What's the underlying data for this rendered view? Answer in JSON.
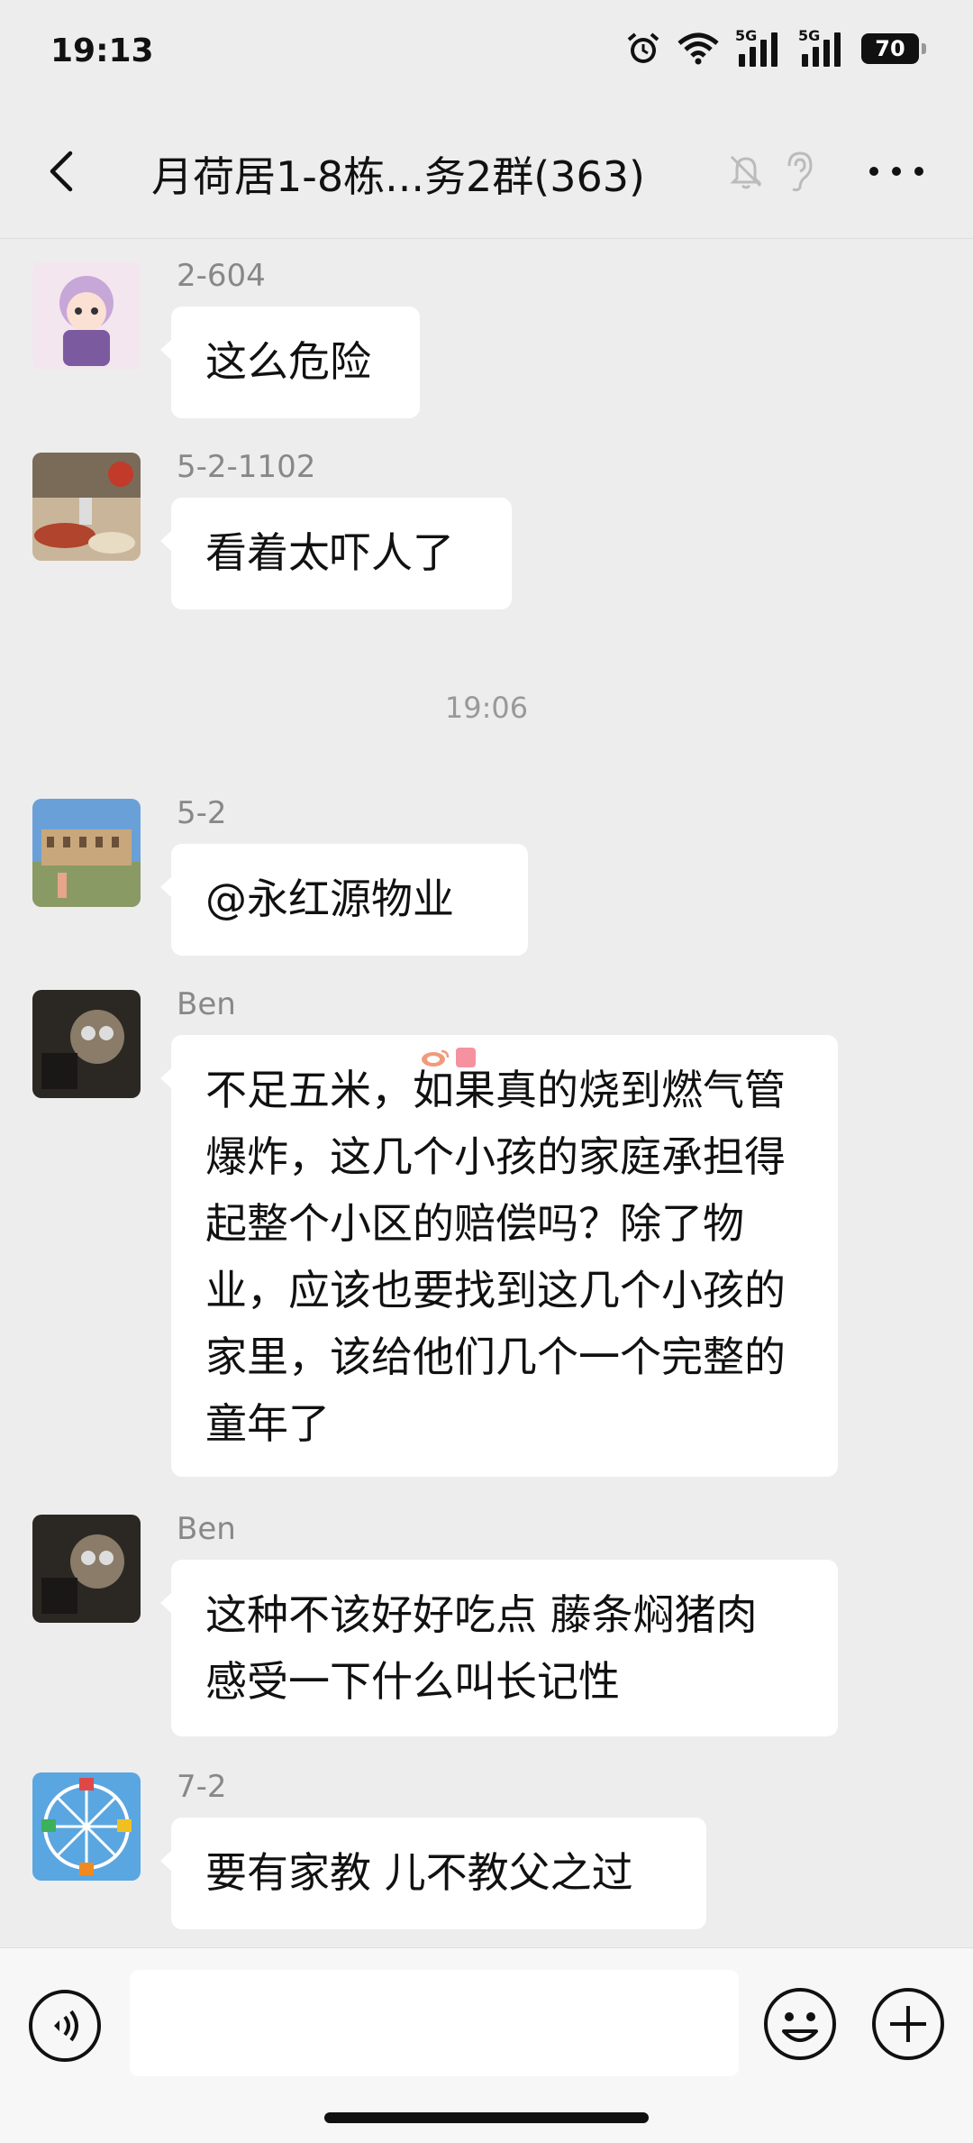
{
  "status_bar": {
    "time": "19:13",
    "network_1": "5G",
    "network_2": "5G",
    "battery": "70"
  },
  "header": {
    "title": "月荷居1-8栋...务2群(363)"
  },
  "timestamp": "19:06",
  "messages": [
    {
      "sender": "2-604",
      "text": "这么危险"
    },
    {
      "sender": "5-2-1102",
      "text": "看着太吓人了"
    },
    {
      "sender": "5-2",
      "text": "@永红源物业"
    },
    {
      "sender": "Ben",
      "text": "不足五米，如果真的烧到燃气管爆炸，这几个小孩的家庭承担得起整个小区的赔偿吗？除了物业，应该也要找到这几个小孩的家里，该给他们几个一个完整的童年了"
    },
    {
      "sender": "Ben",
      "text": "这种不该好好吃点 藤条焖猪肉 感受一下什么叫长记性"
    },
    {
      "sender": "7-2",
      "text": "要有家教 儿不教父之过"
    }
  ],
  "input": {
    "placeholder": ""
  }
}
